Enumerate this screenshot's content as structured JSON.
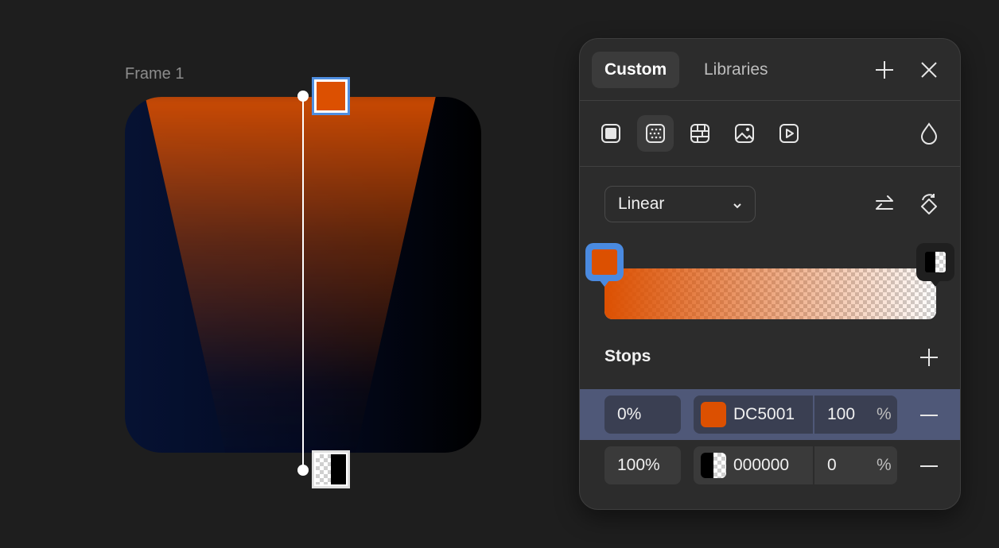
{
  "canvas": {
    "frame_label": "Frame 1",
    "start_stop_color": "#dc5001",
    "end_stop_color": "#000000"
  },
  "panel": {
    "tabs": [
      {
        "label": "Custom",
        "active": true
      },
      {
        "label": "Libraries",
        "active": false
      }
    ],
    "header_icons": [
      "plus-icon",
      "close-icon"
    ],
    "fill_types": [
      "solid-fill-icon",
      "gradient-fill-icon",
      "pattern-fill-icon",
      "image-fill-icon",
      "video-fill-icon"
    ],
    "selected_fill_type": "gradient-fill-icon",
    "opacity_icon": "droplet-icon",
    "gradient_type": "Linear",
    "gradient_actions": [
      "swap-arrows-icon",
      "rotate-icon"
    ],
    "stops_title": "Stops",
    "stops": [
      {
        "position": "0%",
        "hex": "DC5001",
        "alpha": "100",
        "percent_sign": "%",
        "color": "#dc5001",
        "selected": true
      },
      {
        "position": "100%",
        "hex": "000000",
        "alpha": "0",
        "percent_sign": "%",
        "color": "#000000",
        "selected": false
      }
    ]
  }
}
